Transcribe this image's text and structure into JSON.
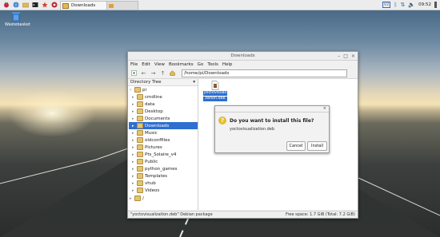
{
  "taskbar": {
    "task_label": "Downloads",
    "clock": "09:52",
    "icons": [
      "raspberry-menu-icon",
      "globe-icon",
      "file-manager-icon",
      "terminal-icon",
      "wolfram-icon",
      "mathematica-icon",
      "folder-task-icon",
      "vnc-icon",
      "bluetooth-icon",
      "network-icon",
      "volume-icon"
    ],
    "tray_vnc_label": "V2"
  },
  "desktop": {
    "trash_label": "Wastebasket"
  },
  "window": {
    "title": "Downloads",
    "menu": [
      "File",
      "Edit",
      "View",
      "Bookmarks",
      "Go",
      "Tools",
      "Help"
    ],
    "path": "/home/pi/Downloads",
    "tree_header": "Directory Tree",
    "tree": {
      "root": "pi",
      "items": [
        "cmdline",
        "data",
        "Desktop",
        "Documents",
        "Downloads",
        "Music",
        "oldconffiles",
        "Pictures",
        "Pts_Solaire_v4",
        "Public",
        "python_games",
        "Templates",
        "vhub",
        "Videos"
      ],
      "bottom": "/",
      "selected": "Downloads"
    },
    "file": {
      "name_line1": "yoctovisuali",
      "name_line2": "zation.deb"
    },
    "status_left": "\"yoctovisualization.deb\" Debian package",
    "status_right": "Free space: 1.7 GiB (Total: 7.2 GiB)"
  },
  "dialog": {
    "question": "Do you want to install this file?",
    "filename": "yoctovisualization.deb",
    "cancel_label": "Cancel",
    "install_label": "Install"
  },
  "colors": {
    "selection": "#2e6fcf",
    "question_icon": "#e6bd29"
  }
}
